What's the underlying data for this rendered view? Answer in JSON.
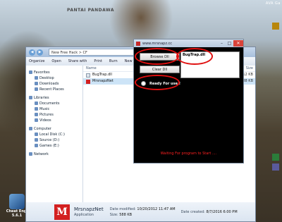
{
  "desktop": {
    "wallpaper_text": "PANTAI PANDAWA",
    "corner_label": "AVA Ga",
    "shortcut_label_1": "Cheat Engi",
    "shortcut_label_2": "5.6.1"
  },
  "explorer": {
    "address": "New Free Hack > CF",
    "toolbar": [
      "Organize",
      "Open",
      "Share with",
      "Print",
      "Burn",
      "New folder"
    ],
    "nav": [
      {
        "label": "Favorites",
        "group": true
      },
      {
        "label": "Desktop",
        "group": false
      },
      {
        "label": "Downloads",
        "group": false
      },
      {
        "label": "Recent Places",
        "group": false
      },
      {
        "label": "Libraries",
        "group": true
      },
      {
        "label": "Documents",
        "group": false
      },
      {
        "label": "Music",
        "group": false
      },
      {
        "label": "Pictures",
        "group": false
      },
      {
        "label": "Videos",
        "group": false
      },
      {
        "label": "Computer",
        "group": true
      },
      {
        "label": "Local Disk (C:)",
        "group": false
      },
      {
        "label": "Source (D:)",
        "group": false
      },
      {
        "label": "Games (E:)",
        "group": false
      },
      {
        "label": "Network",
        "group": true
      }
    ],
    "header_name": "Name",
    "header_size": "Size",
    "files": [
      {
        "name": "BugTrap.dll",
        "size": "2,312 KB"
      },
      {
        "name": "MrsnapzNet",
        "size": "588 KB"
      }
    ],
    "details": {
      "name": "MrsnapzNet",
      "type": "Application",
      "modified_label": "Date modified:",
      "modified": "10/20/2012 11:47 AM",
      "created_label": "Date created:",
      "created": "8/7/2016 6:00 PM",
      "size_label": "Size:",
      "size": "588 KB"
    }
  },
  "injector": {
    "title": "www.mrsnapz.cc",
    "browse_label": "Browse Dll",
    "clear_label": "Clear Dll",
    "dll_entry": "BugTrap.dll",
    "ready_label": "Ready For use !",
    "status": "Waiting For program to Start ....",
    "accent_color": "#e01010"
  }
}
